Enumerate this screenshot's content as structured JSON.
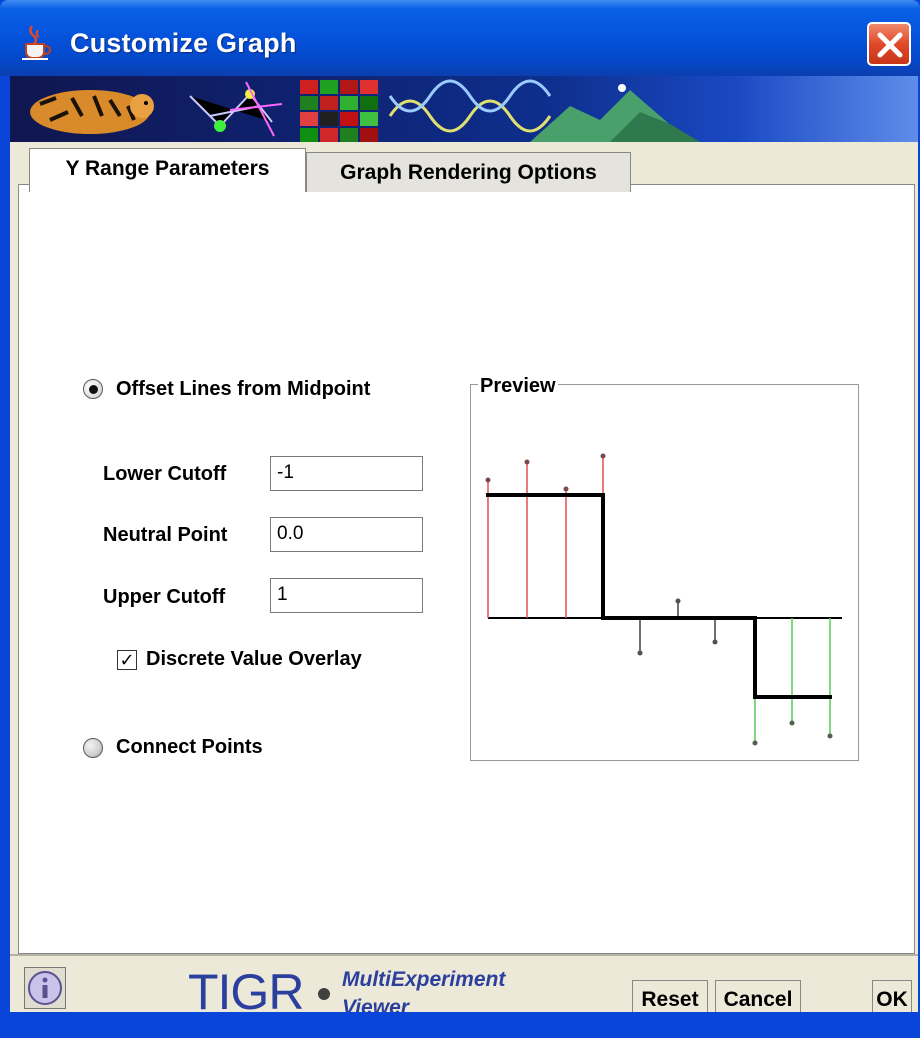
{
  "window": {
    "title": "Customize Graph"
  },
  "tabs": [
    {
      "label": "Y Range Parameters",
      "active": true
    },
    {
      "label": "Graph Rendering Options",
      "active": false
    }
  ],
  "options": {
    "offset_label": "Offset Lines from Midpoint",
    "offset_selected": true,
    "connect_label": "Connect Points",
    "connect_selected": false
  },
  "fields": {
    "lower_cutoff_label": "Lower Cutoff",
    "lower_cutoff_value": "-1",
    "neutral_point_label": "Neutral Point",
    "neutral_point_value": "0.0",
    "upper_cutoff_label": "Upper Cutoff",
    "upper_cutoff_value": "1"
  },
  "overlay": {
    "label": "Discrete Value Overlay",
    "checked": true,
    "check_mark": "✓"
  },
  "preview": {
    "title": "Preview"
  },
  "footer": {
    "logo_text": "TIGR",
    "logo_sub_1": "MultiExperiment",
    "logo_sub_2": "Viewer",
    "reset_label": "Reset",
    "cancel_label": "Cancel",
    "ok_label": "OK"
  },
  "colors": {
    "positive": "#e05050",
    "neutral": "#404040",
    "negative": "#55cc55"
  }
}
